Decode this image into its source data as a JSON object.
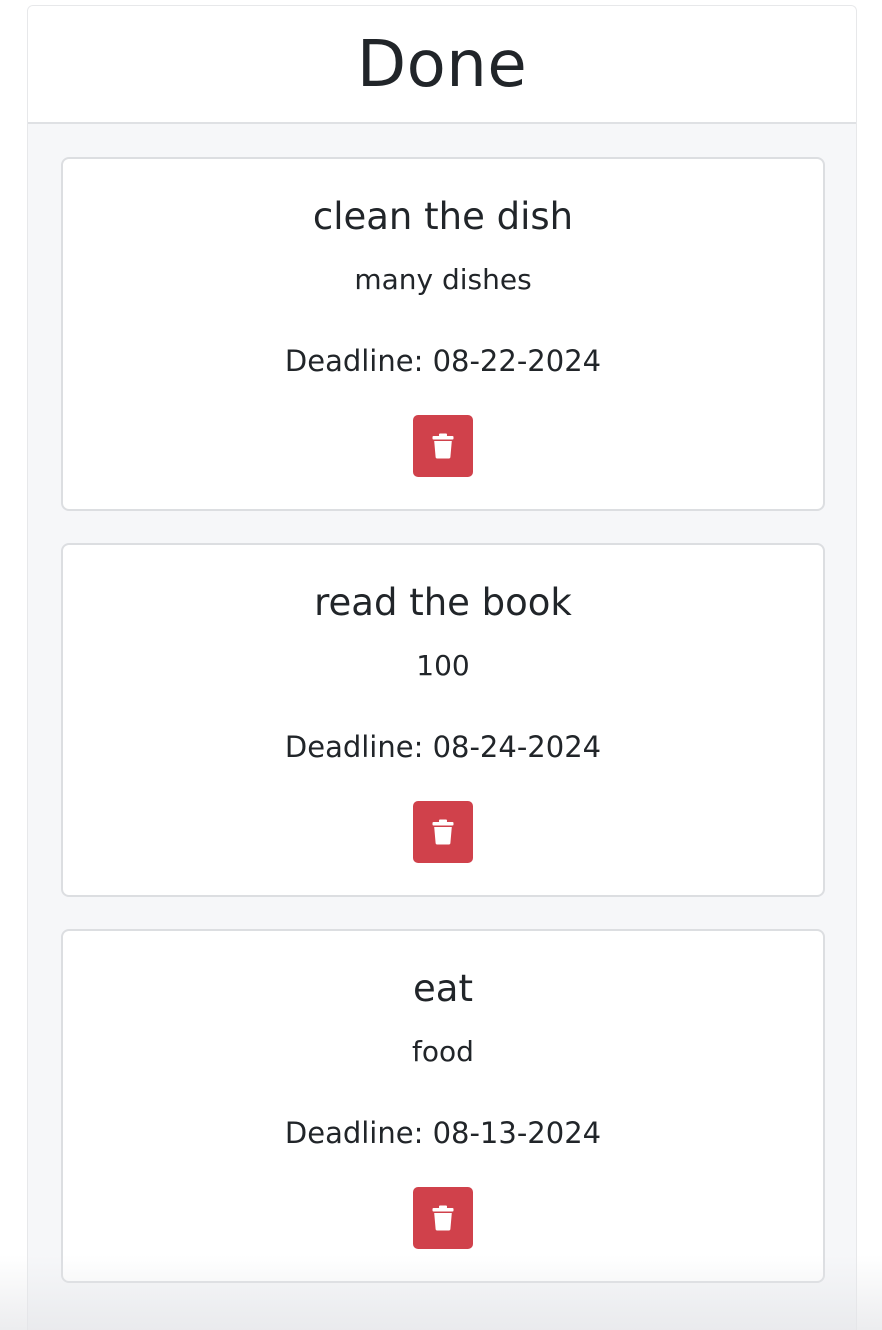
{
  "column": {
    "title": "Done"
  },
  "tasks": [
    {
      "title": "clean the dish",
      "description": "many dishes",
      "deadline": "Deadline: 08-22-2024",
      "delete_icon": "trash-icon"
    },
    {
      "title": "read the book",
      "description": "100",
      "deadline": "Deadline: 08-24-2024",
      "delete_icon": "trash-icon"
    },
    {
      "title": "eat",
      "description": "food",
      "deadline": "Deadline: 08-13-2024",
      "delete_icon": "trash-icon"
    }
  ],
  "colors": {
    "delete_button": "#d0414b",
    "panel_background": "#f6f7f9",
    "text": "#212529"
  }
}
